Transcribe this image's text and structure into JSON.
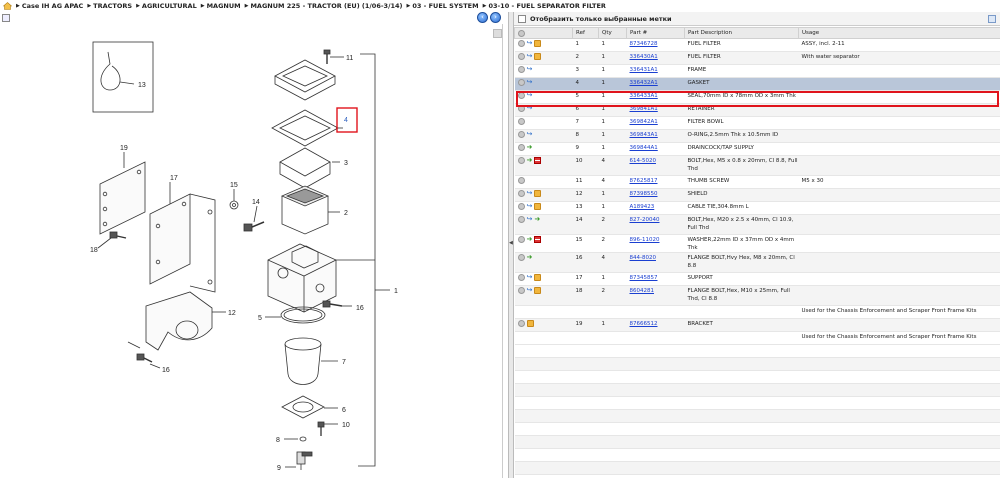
{
  "breadcrumb": [
    "Case IH AG APAC",
    "TRACTORS",
    "AGRICULTURAL",
    "MAGNUM",
    "MAGNUM 225 - TRACTOR (EU) (1/06-3/14)",
    "03 - FUEL SYSTEM",
    "03-10 - FUEL SEPARATOR FILTER"
  ],
  "filter_label": "Отобразить только выбранные метки",
  "columns": [
    "Ref",
    "Qty",
    "Part #",
    "Part Description",
    "Usage"
  ],
  "parts": [
    {
      "icons": [
        "add",
        "link",
        "box"
      ],
      "ref": "1",
      "qty": "1",
      "part": "87346728",
      "desc": "FUEL FILTER",
      "usage": "ASSY, incl. 2-11"
    },
    {
      "icons": [
        "add",
        "link",
        "box"
      ],
      "ref": "2",
      "qty": "1",
      "part": "336430A1",
      "desc": "FUEL FILTER",
      "usage": "With water separator"
    },
    {
      "icons": [
        "add",
        "link"
      ],
      "ref": "3",
      "qty": "1",
      "part": "336431A1",
      "desc": "FRAME",
      "usage": ""
    },
    {
      "icons": [
        "add",
        "link"
      ],
      "ref": "4",
      "qty": "1",
      "part": "336432A1",
      "desc": "GASKET",
      "usage": "",
      "selected": true
    },
    {
      "icons": [
        "add",
        "link"
      ],
      "ref": "5",
      "qty": "1",
      "part": "336433A1",
      "desc": "SEAL,70mm ID x 78mm OD x 3mm Thk",
      "usage": ""
    },
    {
      "icons": [
        "add",
        "link"
      ],
      "ref": "6",
      "qty": "1",
      "part": "369841A1",
      "desc": "RETAINER",
      "usage": ""
    },
    {
      "icons": [
        "add"
      ],
      "ref": "7",
      "qty": "1",
      "part": "369842A1",
      "desc": "FILTER BOWL",
      "usage": ""
    },
    {
      "icons": [
        "add",
        "link"
      ],
      "ref": "8",
      "qty": "1",
      "part": "369843A1",
      "desc": "O-RING,2.5mm Thk x 10.5mm ID",
      "usage": ""
    },
    {
      "icons": [
        "add",
        "replace"
      ],
      "ref": "9",
      "qty": "1",
      "part": "369844A1",
      "desc": "DRAINCOCK/TAP SUPPLY",
      "usage": ""
    },
    {
      "icons": [
        "add",
        "replace",
        "kit"
      ],
      "ref": "10",
      "qty": "4",
      "part": "614-5020",
      "desc": "BOLT,Hex, M5 x 0.8 x 20mm, Cl 8.8, Full Thd",
      "usage": "",
      "tall": true
    },
    {
      "icons": [
        "add"
      ],
      "ref": "11",
      "qty": "4",
      "part": "87625817",
      "desc": "THUMB SCREW",
      "usage": "M5 x 30"
    },
    {
      "icons": [
        "add",
        "link",
        "box"
      ],
      "ref": "12",
      "qty": "1",
      "part": "87398550",
      "desc": "SHIELD",
      "usage": ""
    },
    {
      "icons": [
        "add",
        "link",
        "box"
      ],
      "ref": "13",
      "qty": "1",
      "part": "A189423",
      "desc": "CABLE TIE,304.8mm L",
      "usage": ""
    },
    {
      "icons": [
        "add",
        "link",
        "replace"
      ],
      "ref": "14",
      "qty": "2",
      "part": "827-20040",
      "desc": "BOLT,Hex, M20 x 2.5 x 40mm, Cl 10.9, Full Thd",
      "usage": "",
      "tall": true
    },
    {
      "icons": [
        "add",
        "replace",
        "kit"
      ],
      "ref": "15",
      "qty": "2",
      "part": "896-11020",
      "desc": "WASHER,22mm ID x 37mm OD x 4mm Thk",
      "usage": ""
    },
    {
      "icons": [
        "add",
        "replace"
      ],
      "ref": "16",
      "qty": "4",
      "part": "844-8020",
      "desc": "FLANGE BOLT,Hvy Hex, M8 x 20mm, Cl 8.8",
      "usage": "",
      "tall": true
    },
    {
      "icons": [
        "add",
        "link",
        "box"
      ],
      "ref": "17",
      "qty": "1",
      "part": "87345857",
      "desc": "SUPPORT",
      "usage": ""
    },
    {
      "icons": [
        "add",
        "link",
        "box"
      ],
      "ref": "18",
      "qty": "2",
      "part": "8604281",
      "desc": "FLANGE BOLT,Hex, M10 x 25mm, Full Thd, Cl 8.8",
      "usage": "",
      "tall": true
    },
    {
      "note": "Used for the Chassis Enforcement and Scraper Front Frame Kits"
    },
    {
      "icons": [
        "add",
        "box"
      ],
      "ref": "19",
      "qty": "1",
      "part": "87666512",
      "desc": "BRACKET",
      "usage": ""
    },
    {
      "note": "Used for the Chassis Enforcement and Scraper Front Frame Kits"
    }
  ],
  "filler_rows": 10,
  "diagram": {
    "callouts": [
      "13",
      "11",
      "4",
      "3",
      "2",
      "19",
      "17",
      "15",
      "14",
      "18",
      "1",
      "12",
      "5",
      "16",
      "7",
      "16",
      "6",
      "10",
      "8",
      "9"
    ],
    "highlighted_callout": "4"
  },
  "colors": {
    "highlight": "#e0141c",
    "link": "#1a3fd1",
    "selected_row": "#b9c6d9"
  }
}
